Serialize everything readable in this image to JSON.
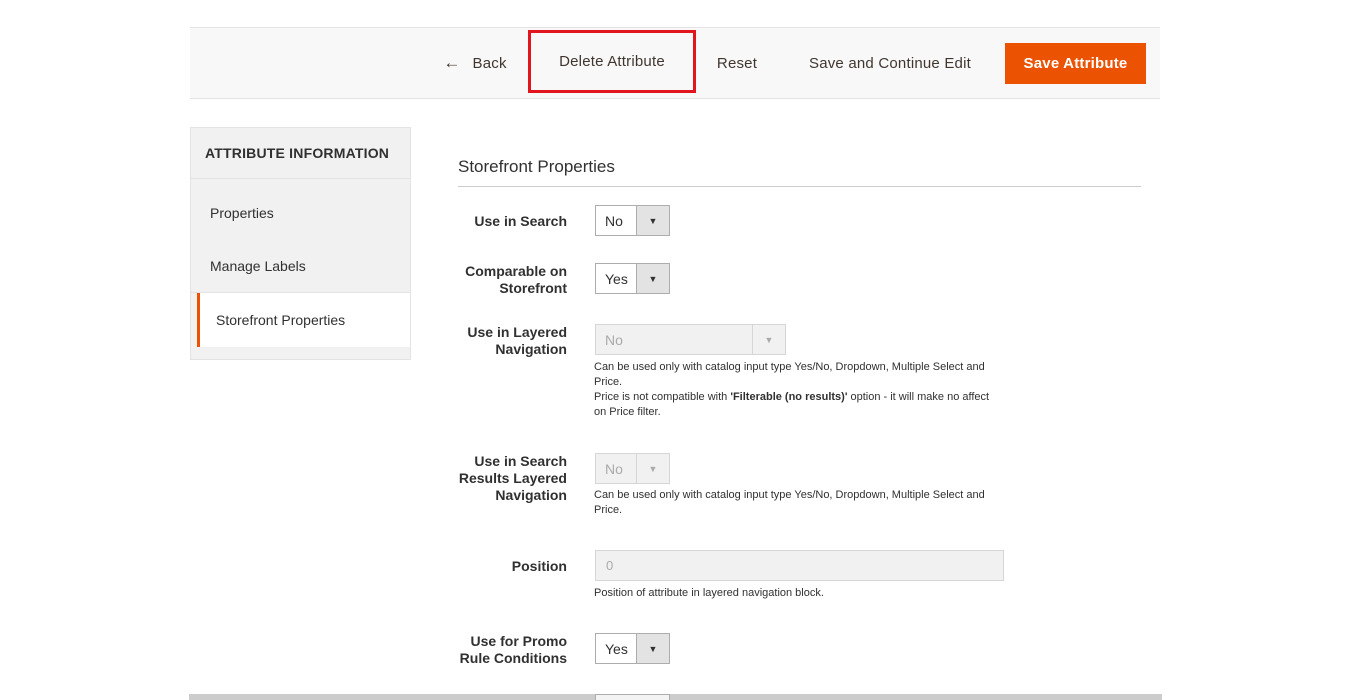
{
  "actions": {
    "back_icon": "arrow-left",
    "back_glyph": "←",
    "back_label": "Back",
    "delete_label": "Delete Attribute",
    "reset_label": "Reset",
    "save_continue_label": "Save and Continue Edit",
    "save_label": "Save Attribute"
  },
  "sidebar": {
    "title": "ATTRIBUTE INFORMATION",
    "items": [
      {
        "label": "Properties"
      },
      {
        "label": "Manage Labels"
      },
      {
        "label": "Storefront Properties",
        "active": true
      }
    ]
  },
  "section": {
    "title": "Storefront Properties"
  },
  "fields": {
    "use_in_search": {
      "label": "Use in Search",
      "value": "No"
    },
    "comparable": {
      "label": "Comparable on Storefront",
      "value": "Yes"
    },
    "layered_nav": {
      "label": "Use in Layered Navigation",
      "value": "No",
      "note1": "Can be used only with catalog input type Yes/No, Dropdown, Multiple Select and Price.",
      "note2_prefix": "Price is not compatible with ",
      "note2_bold": "'Filterable (no results)'",
      "note2_suffix": " option - it will make no affect on Price filter."
    },
    "search_layered_nav": {
      "label": "Use in Search Results Layered Navigation",
      "value": "No",
      "note": "Can be used only with catalog input type Yes/No, Dropdown, Multiple Select and Price."
    },
    "position": {
      "label": "Position",
      "value": "0",
      "note": "Position of attribute in layered navigation block."
    },
    "promo_rules": {
      "label": "Use for Promo Rule Conditions",
      "value": "Yes"
    }
  },
  "colors": {
    "accent": "#eb5202",
    "highlight_box": "#e2141e"
  },
  "caret_glyph": "▼"
}
